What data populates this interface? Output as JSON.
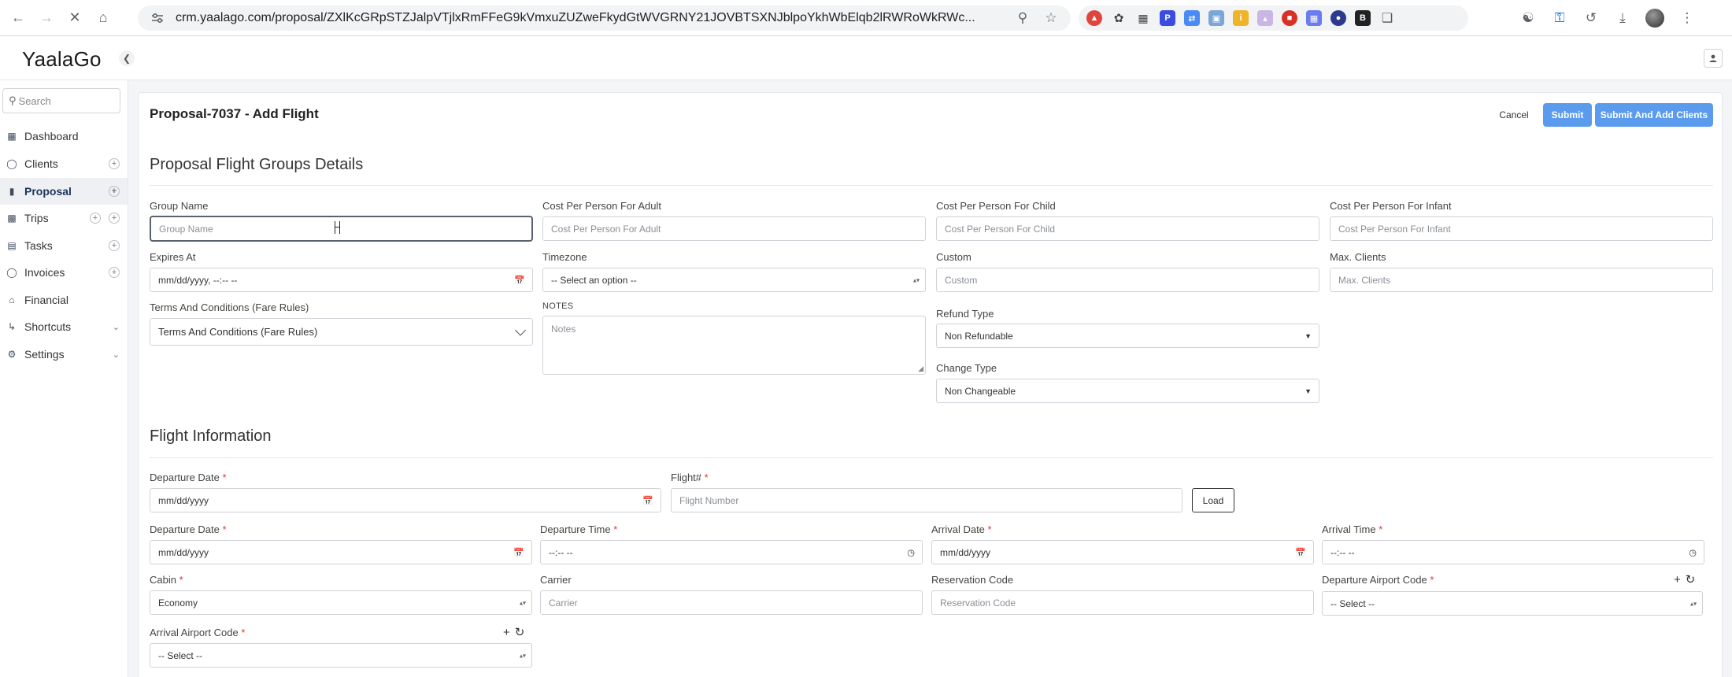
{
  "browser": {
    "url": "crm.yaalago.com/proposal/ZXlKcGRpSTZJalpVTjlxRmFFeG9kVmxuZUZweFkydGtWVGRNY21JOVBTSXNJblpoYkhWbElqb2lRWRoWkRWc..."
  },
  "app": {
    "logo": "YaalaGo"
  },
  "sidebar": {
    "search_placeholder": "Search",
    "items": [
      {
        "label": "Dashboard"
      },
      {
        "label": "Clients"
      },
      {
        "label": "Proposal"
      },
      {
        "label": "Trips"
      },
      {
        "label": "Tasks"
      },
      {
        "label": "Invoices"
      },
      {
        "label": "Financial"
      },
      {
        "label": "Shortcuts"
      },
      {
        "label": "Settings"
      }
    ]
  },
  "page": {
    "title": "Proposal-7037 - Add Flight",
    "cancel_label": "Cancel",
    "submit_label": "Submit",
    "submit_add_clients_label": "Submit And Add Clients"
  },
  "groups": {
    "section_title": "Proposal Flight Groups Details",
    "group_name": {
      "label": "Group Name",
      "placeholder": "Group Name"
    },
    "cost_adult": {
      "label": "Cost Per Person For Adult",
      "placeholder": "Cost Per Person For Adult"
    },
    "cost_child": {
      "label": "Cost Per Person For Child",
      "placeholder": "Cost Per Person For Child"
    },
    "cost_infant": {
      "label": "Cost Per Person For Infant",
      "placeholder": "Cost Per Person For Infant"
    },
    "expires_at": {
      "label": "Expires At",
      "value": "mm/dd/yyyy, --:-- --"
    },
    "timezone": {
      "label": "Timezone",
      "value": "-- Select an option --"
    },
    "custom": {
      "label": "Custom",
      "placeholder": "Custom"
    },
    "max_clients": {
      "label": "Max. Clients",
      "placeholder": "Max. Clients"
    },
    "terms": {
      "label": "Terms And Conditions (Fare Rules)",
      "value": "Terms And Conditions (Fare Rules)"
    },
    "notes": {
      "label": "NOTES",
      "placeholder": "Notes"
    },
    "refund_type": {
      "label": "Refund Type",
      "value": "Non Refundable"
    },
    "change_type": {
      "label": "Change Type",
      "value": "Non Changeable"
    }
  },
  "flight": {
    "section_title": "Flight Information",
    "required_mark": "*",
    "lookup_date": {
      "label": "Departure Date",
      "value": "mm/dd/yyyy"
    },
    "flight_number": {
      "label": "Flight#",
      "placeholder": "Flight Number"
    },
    "load_label": "Load",
    "departure_date": {
      "label": "Departure Date",
      "value": "mm/dd/yyyy"
    },
    "departure_time": {
      "label": "Departure Time",
      "value": "--:-- --"
    },
    "arrival_date": {
      "label": "Arrival Date",
      "value": "mm/dd/yyyy"
    },
    "arrival_time": {
      "label": "Arrival Time",
      "value": "--:-- --"
    },
    "cabin": {
      "label": "Cabin",
      "value": "Economy"
    },
    "carrier": {
      "label": "Carrier",
      "placeholder": "Carrier"
    },
    "reservation_code": {
      "label": "Reservation Code",
      "placeholder": "Reservation Code"
    },
    "departure_airport": {
      "label": "Departure Airport Code",
      "value": "-- Select --"
    },
    "arrival_airport": {
      "label": "Arrival Airport Code",
      "value": "-- Select --"
    }
  },
  "colors": {
    "primary_button": "#5b9bee",
    "required": "#d9363e",
    "active_nav_bg": "#eef0f3"
  },
  "icons": {
    "back": "arrow-left-icon",
    "forward": "arrow-right-icon",
    "stop": "close-icon",
    "home": "home-icon",
    "zoom": "magnifier-icon",
    "bookmark": "star-icon"
  }
}
